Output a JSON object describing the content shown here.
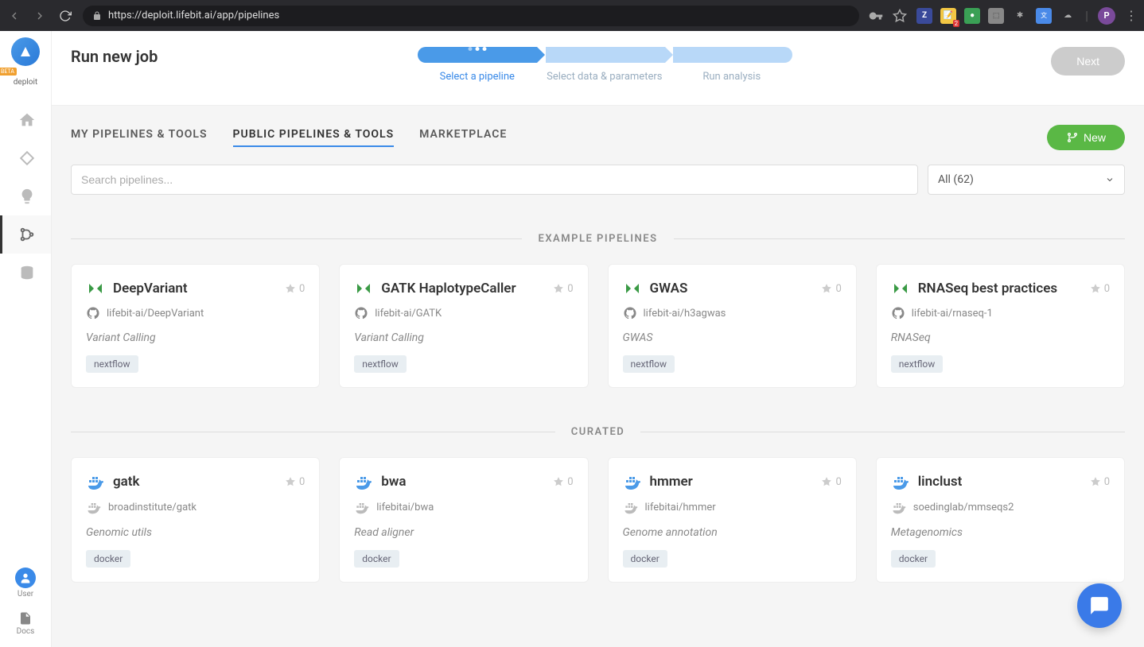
{
  "browser": {
    "url": "https://deploit.lifebit.ai/app/pipelines",
    "avatar_initial": "P",
    "ext_badge": "2",
    "ext_off": "off"
  },
  "sidebar": {
    "logo_text": "deploit",
    "logo_beta": "BETA",
    "user_label": "User",
    "docs_label": "Docs"
  },
  "header": {
    "title": "Run new job",
    "next_label": "Next",
    "steps": [
      "Select a pipeline",
      "Select data & parameters",
      "Run analysis"
    ]
  },
  "tabs": {
    "items": [
      "MY PIPELINES & TOOLS",
      "PUBLIC PIPELINES & TOOLS",
      "MARKETPLACE"
    ],
    "new_label": "New"
  },
  "filters": {
    "search_placeholder": "Search pipelines...",
    "dropdown_value": "All (62)"
  },
  "sections": [
    {
      "title": "EXAMPLE PIPELINES",
      "cards": [
        {
          "title": "DeepVariant",
          "icon_type": "nf",
          "stars": "0",
          "repo_icon": "github",
          "repo": "lifebit-ai/DeepVariant",
          "desc": "Variant Calling",
          "tag": "nextflow"
        },
        {
          "title": "GATK HaplotypeCaller",
          "icon_type": "nf",
          "stars": "0",
          "repo_icon": "github",
          "repo": "lifebit-ai/GATK",
          "desc": "Variant Calling",
          "tag": "nextflow"
        },
        {
          "title": "GWAS",
          "icon_type": "nf",
          "stars": "0",
          "repo_icon": "github",
          "repo": "lifebit-ai/h3agwas",
          "desc": "GWAS",
          "tag": "nextflow"
        },
        {
          "title": "RNASeq best practices",
          "icon_type": "nf",
          "stars": "0",
          "repo_icon": "github",
          "repo": "lifebit-ai/rnaseq-1",
          "desc": "RNASeq",
          "tag": "nextflow"
        }
      ]
    },
    {
      "title": "CURATED",
      "cards": [
        {
          "title": "gatk",
          "icon_type": "docker",
          "stars": "0",
          "repo_icon": "docker",
          "repo": "broadinstitute/gatk",
          "desc": "Genomic utils",
          "tag": "docker"
        },
        {
          "title": "bwa",
          "icon_type": "docker",
          "stars": "0",
          "repo_icon": "docker",
          "repo": "lifebitai/bwa",
          "desc": "Read aligner",
          "tag": "docker"
        },
        {
          "title": "hmmer",
          "icon_type": "docker",
          "stars": "0",
          "repo_icon": "docker",
          "repo": "lifebitai/hmmer",
          "desc": "Genome annotation",
          "tag": "docker"
        },
        {
          "title": "linclust",
          "icon_type": "docker",
          "stars": "0",
          "repo_icon": "docker",
          "repo": "soedinglab/mmseqs2",
          "desc": "Metagenomics",
          "tag": "docker"
        }
      ]
    }
  ]
}
